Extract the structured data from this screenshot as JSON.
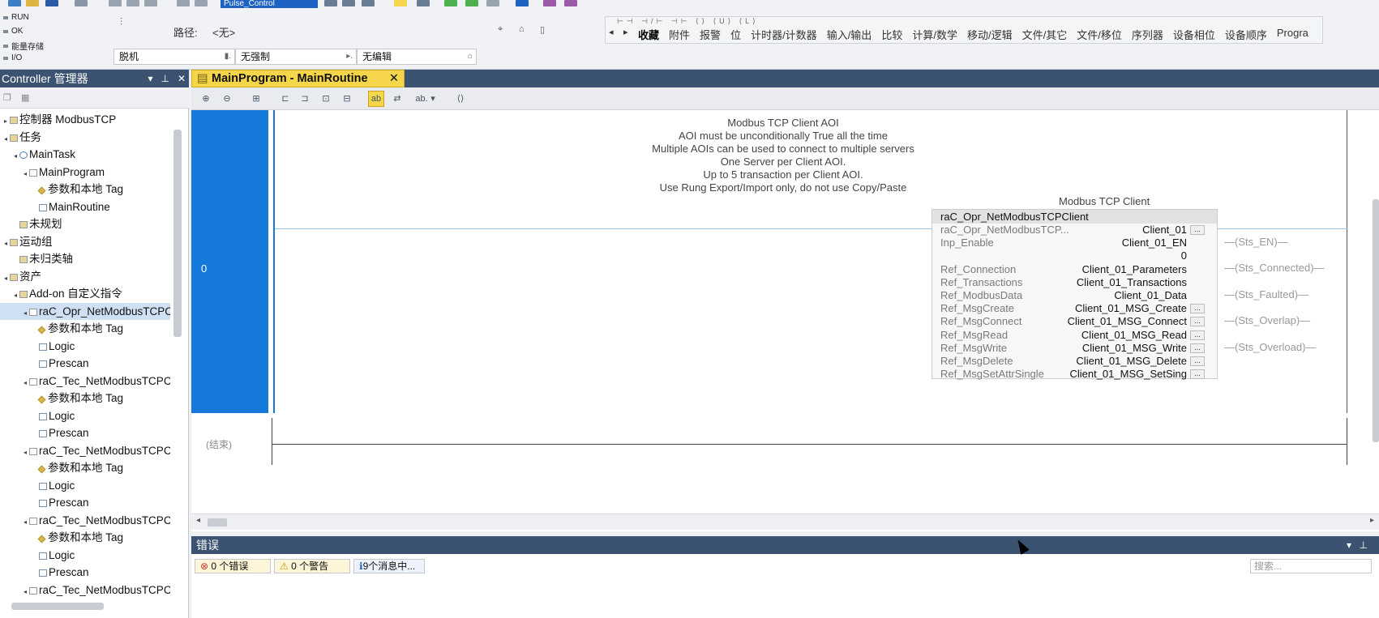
{
  "top": {
    "title_input_value": "Pulse_Control",
    "status_labels": [
      "RUN",
      "OK",
      "能量存储",
      "I/O"
    ],
    "path_label": "路径:",
    "path_value": "<无>",
    "mode_offline": "脱机",
    "mode_force": "无强制",
    "mode_edit": "无编辑"
  },
  "palette": {
    "tabs": [
      "收藏",
      "附件",
      "报警",
      "位",
      "计时器/计数器",
      "输入/输出",
      "比较",
      "计算/数学",
      "移动/逻辑",
      "文件/其它",
      "文件/移位",
      "序列器",
      "设备相位",
      "设备顺序",
      "Progra"
    ],
    "active_index": 0
  },
  "controller_panel": {
    "title": "Controller 管理器",
    "tree": [
      {
        "label": "控制器 ModbusTCP",
        "level": 0,
        "icon": "folder-icon",
        "expand": "▸"
      },
      {
        "label": "任务",
        "level": 0,
        "icon": "folder-icon",
        "expand": "◂"
      },
      {
        "label": "MainTask",
        "level": 1,
        "icon": "task-icon",
        "expand": "◂"
      },
      {
        "label": "MainProgram",
        "level": 2,
        "icon": "program-icon",
        "expand": "◂"
      },
      {
        "label": "参数和本地 Tag",
        "level": 3,
        "icon": "tag-icon",
        "expand": ""
      },
      {
        "label": "MainRoutine",
        "level": 3,
        "icon": "routine-icon",
        "expand": ""
      },
      {
        "label": "未规划",
        "level": 1,
        "icon": "folder-icon",
        "expand": ""
      },
      {
        "label": "运动组",
        "level": 0,
        "icon": "folder-icon",
        "expand": "◂"
      },
      {
        "label": "未归类轴",
        "level": 1,
        "icon": "folder-icon",
        "expand": ""
      },
      {
        "label": "资产",
        "level": 0,
        "icon": "folder-icon",
        "expand": "◂"
      },
      {
        "label": "Add-on 自定义指令",
        "level": 1,
        "icon": "folder-icon",
        "expand": "◂"
      },
      {
        "label": "raC_Opr_NetModbusTCPC",
        "level": 2,
        "icon": "aoi-icon",
        "expand": "◂",
        "selected": true
      },
      {
        "label": "参数和本地 Tag",
        "level": 3,
        "icon": "tag-icon",
        "expand": ""
      },
      {
        "label": "Logic",
        "level": 3,
        "icon": "logic-icon",
        "expand": ""
      },
      {
        "label": "Prescan",
        "level": 3,
        "icon": "logic-icon",
        "expand": ""
      },
      {
        "label": "raC_Tec_NetModbusTCPCl",
        "level": 2,
        "icon": "aoi-icon",
        "expand": "◂"
      },
      {
        "label": "参数和本地 Tag",
        "level": 3,
        "icon": "tag-icon",
        "expand": ""
      },
      {
        "label": "Logic",
        "level": 3,
        "icon": "logic-icon",
        "expand": ""
      },
      {
        "label": "Prescan",
        "level": 3,
        "icon": "logic-icon",
        "expand": ""
      },
      {
        "label": "raC_Tec_NetModbusTCPCl",
        "level": 2,
        "icon": "aoi-icon",
        "expand": "◂"
      },
      {
        "label": "参数和本地 Tag",
        "level": 3,
        "icon": "tag-icon",
        "expand": ""
      },
      {
        "label": "Logic",
        "level": 3,
        "icon": "logic-icon",
        "expand": ""
      },
      {
        "label": "Prescan",
        "level": 3,
        "icon": "logic-icon",
        "expand": ""
      },
      {
        "label": "raC_Tec_NetModbusTCPCl",
        "level": 2,
        "icon": "aoi-icon",
        "expand": "◂"
      },
      {
        "label": "参数和本地 Tag",
        "level": 3,
        "icon": "tag-icon",
        "expand": ""
      },
      {
        "label": "Logic",
        "level": 3,
        "icon": "logic-icon",
        "expand": ""
      },
      {
        "label": "Prescan",
        "level": 3,
        "icon": "logic-icon",
        "expand": ""
      },
      {
        "label": "raC_Tec_NetModbusTCPCl",
        "level": 2,
        "icon": "aoi-icon",
        "expand": "◂"
      }
    ]
  },
  "editor": {
    "tab_label": "MainProgram - MainRoutine",
    "rung_number": "0",
    "end_label": "(结束)",
    "comment_lines": [
      "Modbus TCP Client AOI",
      "AOI must be unconditionally True all the time",
      "Multiple AOIs can be used to connect to multiple servers",
      "One Server per Client AOI.",
      "Up to 5 transaction per Client AOI.",
      "Use Rung Export/Import only, do not use Copy/Paste"
    ],
    "aoi": {
      "caption": "Modbus TCP Client",
      "name": "raC_Opr_NetModbusTCPClient",
      "rows": [
        {
          "param": "raC_Opr_NetModbusTCP...",
          "value": "Client_01",
          "dots": true
        },
        {
          "param": "Inp_Enable",
          "value": "Client_01_EN",
          "dots": false
        },
        {
          "param": "",
          "value": "0",
          "dots": false
        },
        {
          "param": "Ref_Connection",
          "value": "Client_01_Parameters",
          "dots": false
        },
        {
          "param": "Ref_Transactions",
          "value": "Client_01_Transactions",
          "dots": false
        },
        {
          "param": "Ref_ModbusData",
          "value": "Client_01_Data",
          "dots": false
        },
        {
          "param": "Ref_MsgCreate",
          "value": "Client_01_MSG_Create",
          "dots": true
        },
        {
          "param": "Ref_MsgConnect",
          "value": "Client_01_MSG_Connect",
          "dots": true
        },
        {
          "param": "Ref_MsgRead",
          "value": "Client_01_MSG_Read",
          "dots": true
        },
        {
          "param": "Ref_MsgWrite",
          "value": "Client_01_MSG_Write",
          "dots": true
        },
        {
          "param": "Ref_MsgDelete",
          "value": "Client_01_MSG_Delete",
          "dots": true
        },
        {
          "param": "Ref_MsgSetAttrSingle",
          "value": "Client_01_MSG_SetSing",
          "dots": true
        }
      ],
      "dots_label": "..."
    },
    "outputs": [
      "Sts_EN",
      "Sts_Connected",
      "Sts_Faulted",
      "Sts_Overlap",
      "Sts_Overload"
    ]
  },
  "errors_panel": {
    "title": "错误",
    "errors_label": "0 个错误",
    "warnings_label": "0 个警告",
    "messages_label": "9个消息中...",
    "search_placeholder": "搜索..."
  }
}
